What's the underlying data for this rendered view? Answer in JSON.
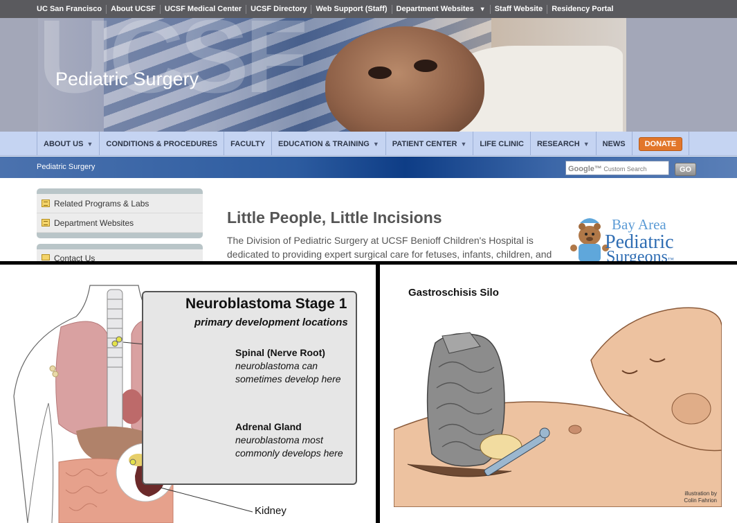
{
  "topbar": {
    "links": [
      {
        "label": "UC San Francisco"
      },
      {
        "label": "About UCSF"
      },
      {
        "label": "UCSF Medical Center"
      },
      {
        "label": "UCSF Directory"
      },
      {
        "label": "Web Support (Staff)"
      },
      {
        "label": "Department Websites",
        "has_dropdown": true
      },
      {
        "label": "Staff Website"
      },
      {
        "label": "Residency Portal"
      }
    ],
    "background": "#5a5a5e"
  },
  "banner": {
    "watermark": "UCSF",
    "title": "Pediatric Surgery"
  },
  "nav": {
    "items": [
      {
        "label": "ABOUT US",
        "has_dropdown": true
      },
      {
        "label": "CONDITIONS & PROCEDURES",
        "has_dropdown": false
      },
      {
        "label": "FACULTY",
        "has_dropdown": false
      },
      {
        "label": "EDUCATION & TRAINING",
        "has_dropdown": true
      },
      {
        "label": "PATIENT CENTER",
        "has_dropdown": true
      },
      {
        "label": "LIFE CLINIC",
        "has_dropdown": false
      },
      {
        "label": "RESEARCH",
        "has_dropdown": true
      },
      {
        "label": "NEWS",
        "has_dropdown": false
      }
    ],
    "donate_label": "DONATE",
    "donate_color": "#e2762a",
    "caret": "▼"
  },
  "breadcrumb": {
    "current": "Pediatric Surgery"
  },
  "search": {
    "brand": "Google™",
    "placeholder": "Custom Search",
    "go_label": "GO"
  },
  "sidebar": {
    "items": [
      {
        "label": "Related Programs & Labs",
        "icon": "list-icon"
      },
      {
        "label": "Department Websites",
        "icon": "list-icon"
      }
    ],
    "second_box_item": {
      "label": "Contact Us",
      "icon": "mail-icon"
    }
  },
  "main": {
    "headline": "Little People, Little Incisions",
    "intro": "The Division of Pediatric Surgery at UCSF Benioff Children's Hospital is dedicated to providing expert surgical care for fetuses, infants, children, and"
  },
  "logo": {
    "line1": "Bay Area",
    "line2": "Pediatric",
    "line3": "Surgeons",
    "tm": "™"
  },
  "illustration_left": {
    "title": "Neuroblastoma Stage 1",
    "subtitle": "primary development locations",
    "callouts": [
      {
        "heading": "Spinal (Nerve Root)",
        "line1": "neuroblastoma can",
        "line2": "sometimes develop here"
      },
      {
        "heading": "Adrenal Gland",
        "line1": "neuroblastoma most",
        "line2": "commonly develops here"
      }
    ],
    "kidney_label": "Kidney"
  },
  "illustration_right": {
    "title": "Gastroschisis Silo",
    "credit_line1": "illustration by",
    "credit_line2": "Colin Fahrion"
  }
}
